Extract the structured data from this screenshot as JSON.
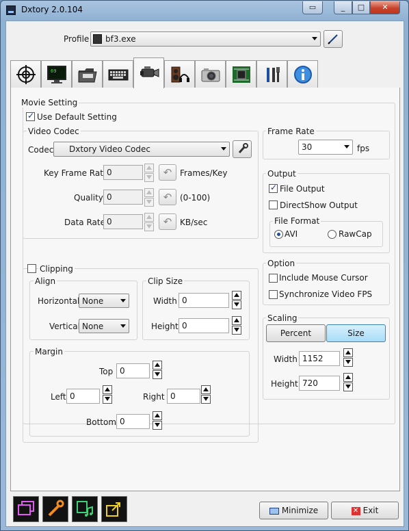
{
  "window": {
    "title": "Dxtory 2.0.104"
  },
  "profile": {
    "label": "Profile",
    "value": "bf3.exe"
  },
  "tabs": [
    {
      "name": "target-icon"
    },
    {
      "name": "monitor-icon"
    },
    {
      "name": "folder-icon"
    },
    {
      "name": "keyboard-icon"
    },
    {
      "name": "camcorder-icon"
    },
    {
      "name": "speaker-headphone-icon"
    },
    {
      "name": "camera-icon"
    },
    {
      "name": "chip-icon"
    },
    {
      "name": "tools-icon"
    },
    {
      "name": "info-icon"
    }
  ],
  "movie_setting": {
    "title": "Movie Setting",
    "use_default": "Use Default Setting",
    "video_codec": {
      "title": "Video Codec",
      "codec_label": "Codec",
      "codec_value": "Dxtory Video Codec",
      "key_frame_label": "Key Frame Rate",
      "key_frame_value": "0",
      "key_frame_unit": "Frames/Key",
      "quality_label": "Quality",
      "quality_value": "0",
      "quality_unit": "(0-100)",
      "data_rate_label": "Data Rate",
      "data_rate_value": "0",
      "data_rate_unit": "KB/sec"
    },
    "frame_rate": {
      "title": "Frame Rate",
      "value": "30",
      "unit": "fps"
    },
    "output": {
      "title": "Output",
      "file_output": "File Output",
      "directshow_output": "DirectShow Output",
      "file_format": {
        "title": "File Format",
        "avi": "AVI",
        "rawcap": "RawCap"
      }
    },
    "clipping": {
      "title": "Clipping",
      "align": {
        "title": "Align",
        "horizontal_label": "Horizontal",
        "horizontal_value": "None",
        "vertical_label": "Vertical",
        "vertical_value": "None"
      },
      "clip_size": {
        "title": "Clip Size",
        "width_label": "Width",
        "width_value": "0",
        "height_label": "Height",
        "height_value": "0"
      },
      "margin": {
        "title": "Margin",
        "top_label": "Top",
        "top_value": "0",
        "left_label": "Left",
        "left_value": "0",
        "right_label": "Right",
        "right_value": "0",
        "bottom_label": "Bottom",
        "bottom_value": "0"
      }
    },
    "option": {
      "title": "Option",
      "include_mouse": "Include Mouse Cursor",
      "sync_fps": "Synchronize Video FPS"
    },
    "scaling": {
      "title": "Scaling",
      "percent": "Percent",
      "size": "Size",
      "width_label": "Width",
      "width_value": "1152",
      "height_label": "Height",
      "height_value": "720"
    }
  },
  "footer": {
    "minimize": "Minimize",
    "exit": "Exit"
  }
}
